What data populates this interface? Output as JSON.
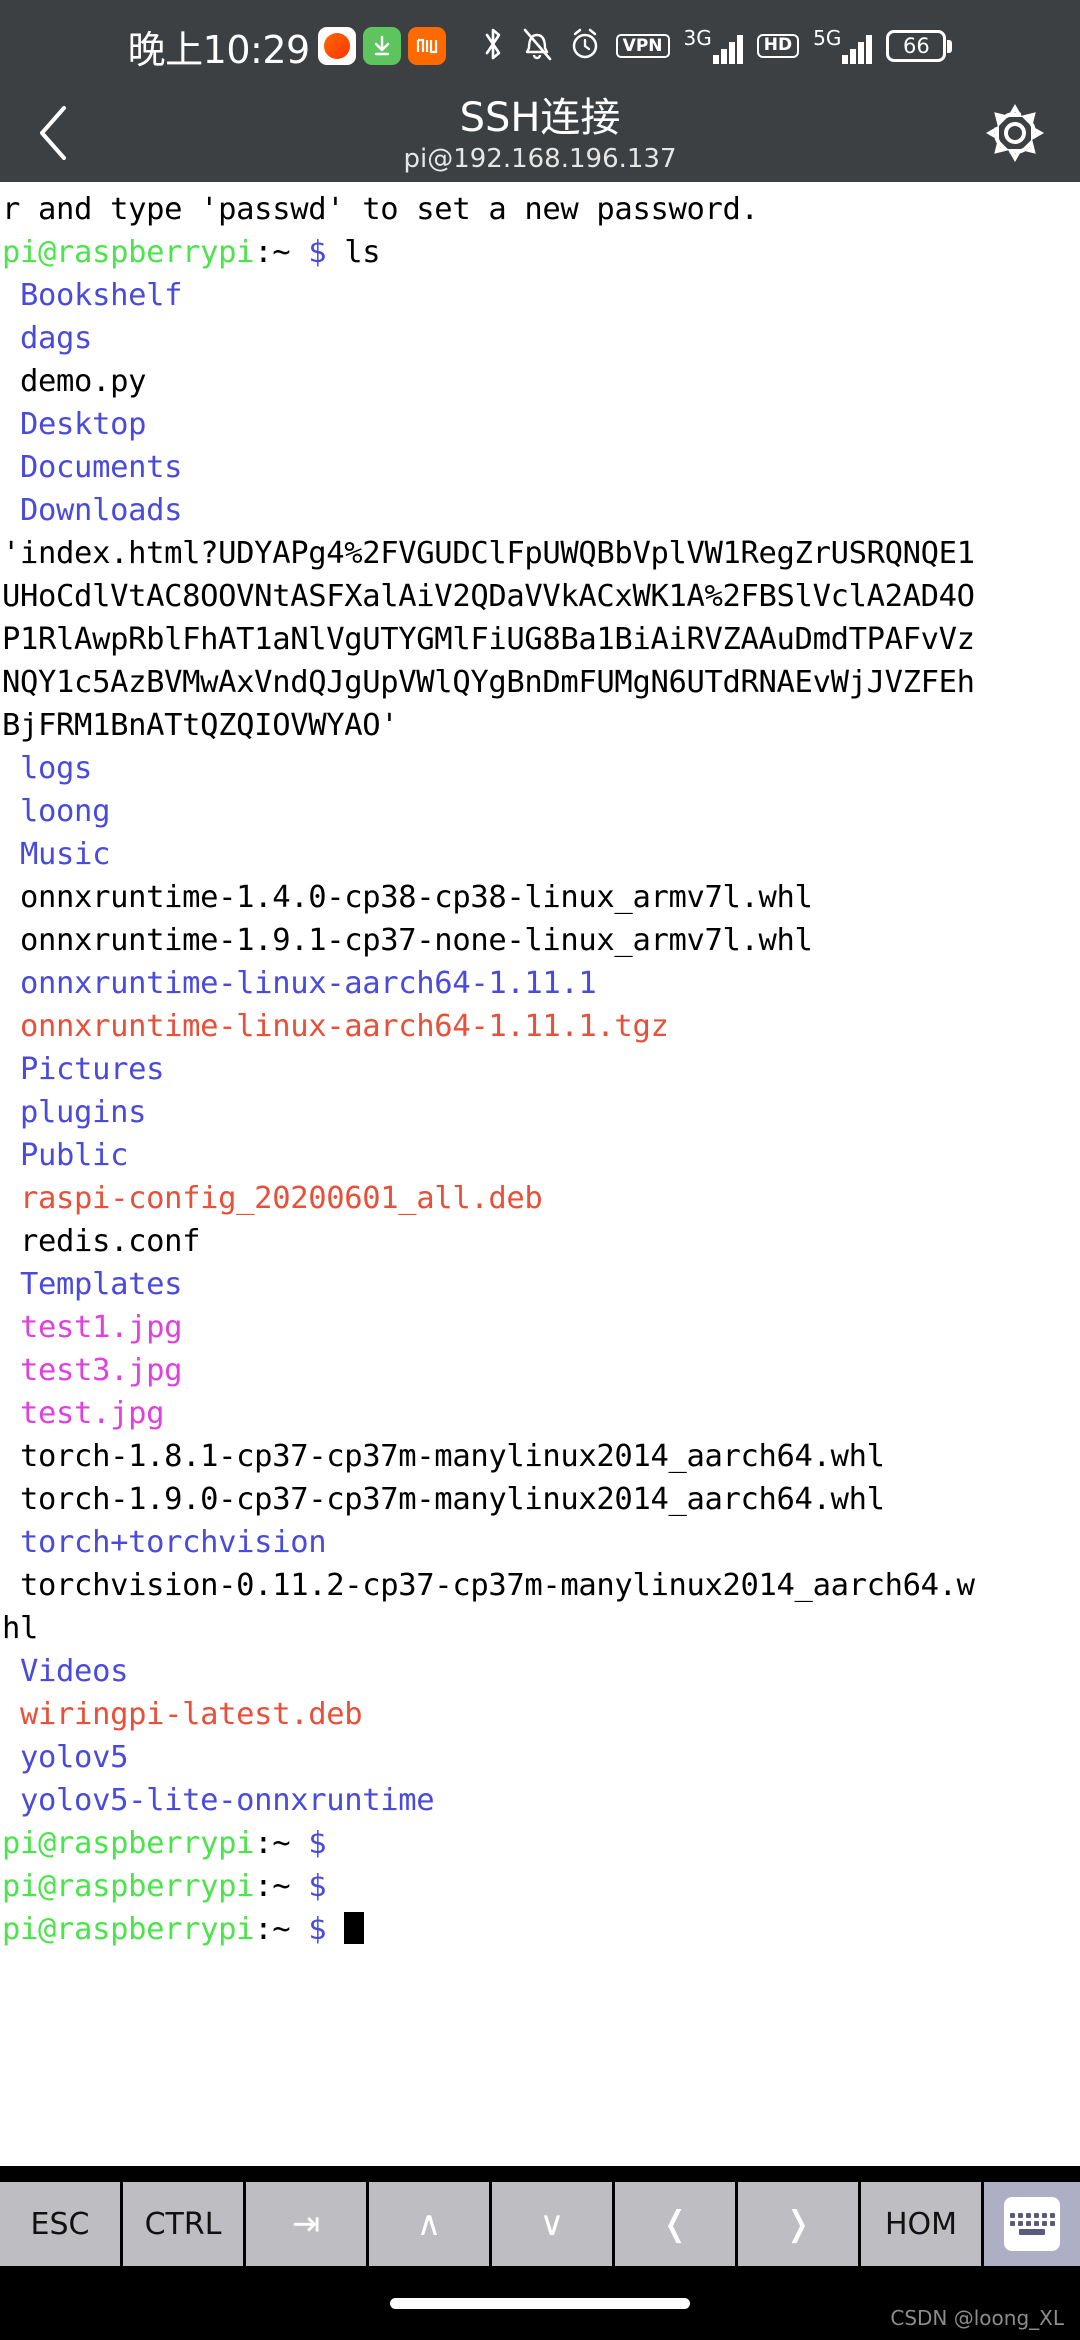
{
  "statusbar": {
    "time": "晚上10:29",
    "app_icons": [
      "taobao-icon",
      "download-icon",
      "mi-icon"
    ],
    "system_icons": [
      "bluetooth-icon",
      "vibrate-off-icon",
      "alarm-icon",
      "vpn-icon",
      "signal-3g-icon",
      "hd-icon",
      "signal-5g-icon",
      "battery-icon"
    ],
    "vpn_label": "VPN",
    "hd_label": "HD",
    "net_3g_label": "3G",
    "net_5g_label": "5G",
    "battery_level": "66"
  },
  "header": {
    "back_icon": "back-chevron-icon",
    "title": "SSH连接",
    "subtitle": "pi@192.168.196.137",
    "settings_icon": "gear-icon"
  },
  "terminal": {
    "lines": [
      {
        "segments": [
          {
            "text": "r and type 'passwd' to set a new password.",
            "color": "black"
          }
        ]
      },
      {
        "segments": [
          {
            "text": "",
            "color": "black"
          }
        ]
      },
      {
        "segments": [
          {
            "text": "pi@raspberrypi",
            "color": "green"
          },
          {
            "text": ":~ ",
            "color": "black"
          },
          {
            "text": "$",
            "color": "blue"
          },
          {
            "text": " ls",
            "color": "black"
          }
        ]
      },
      {
        "segments": [
          {
            "text": " Bookshelf",
            "color": "blue"
          }
        ]
      },
      {
        "segments": [
          {
            "text": " dags",
            "color": "blue"
          }
        ]
      },
      {
        "segments": [
          {
            "text": " demo.py",
            "color": "black"
          }
        ]
      },
      {
        "segments": [
          {
            "text": " Desktop",
            "color": "blue"
          }
        ]
      },
      {
        "segments": [
          {
            "text": " Documents",
            "color": "blue"
          }
        ]
      },
      {
        "segments": [
          {
            "text": " Downloads",
            "color": "blue"
          }
        ]
      },
      {
        "segments": [
          {
            "text": "'index.html?UDYAPg4%2FVGUDClFpUWQBbVplVW1RegZrUSRQNQE1",
            "color": "black"
          }
        ]
      },
      {
        "segments": [
          {
            "text": "UHoCdlVtAC8OOVNtASFXalAiV2QDaVVkACxWK1A%2FBSlVclA2AD4O",
            "color": "black"
          }
        ]
      },
      {
        "segments": [
          {
            "text": "P1RlAwpRblFhAT1aNlVgUTYGMlFiUG8Ba1BiAiRVZAAuDmdTPAFvVz",
            "color": "black"
          }
        ]
      },
      {
        "segments": [
          {
            "text": "NQY1c5AzBVMwAxVndQJgUpVWlQYgBnDmFUMgN6UTdRNAEvWjJVZFEh",
            "color": "black"
          }
        ]
      },
      {
        "segments": [
          {
            "text": "BjFRM1BnATtQZQIOVWYAO'",
            "color": "black"
          }
        ]
      },
      {
        "segments": [
          {
            "text": " logs",
            "color": "blue"
          }
        ]
      },
      {
        "segments": [
          {
            "text": " loong",
            "color": "blue"
          }
        ]
      },
      {
        "segments": [
          {
            "text": " Music",
            "color": "blue"
          }
        ]
      },
      {
        "segments": [
          {
            "text": " onnxruntime-1.4.0-cp38-cp38-linux_armv7l.whl",
            "color": "black"
          }
        ]
      },
      {
        "segments": [
          {
            "text": " onnxruntime-1.9.1-cp37-none-linux_armv7l.whl",
            "color": "black"
          }
        ]
      },
      {
        "segments": [
          {
            "text": " onnxruntime-linux-aarch64-1.11.1",
            "color": "blue"
          }
        ]
      },
      {
        "segments": [
          {
            "text": " onnxruntime-linux-aarch64-1.11.1.tgz",
            "color": "red"
          }
        ]
      },
      {
        "segments": [
          {
            "text": " Pictures",
            "color": "blue"
          }
        ]
      },
      {
        "segments": [
          {
            "text": " plugins",
            "color": "blue"
          }
        ]
      },
      {
        "segments": [
          {
            "text": " Public",
            "color": "blue"
          }
        ]
      },
      {
        "segments": [
          {
            "text": " raspi-config_20200601_all.deb",
            "color": "red"
          }
        ]
      },
      {
        "segments": [
          {
            "text": " redis.conf",
            "color": "black"
          }
        ]
      },
      {
        "segments": [
          {
            "text": " Templates",
            "color": "blue"
          }
        ]
      },
      {
        "segments": [
          {
            "text": " test1.jpg",
            "color": "magenta"
          }
        ]
      },
      {
        "segments": [
          {
            "text": " test3.jpg",
            "color": "magenta"
          }
        ]
      },
      {
        "segments": [
          {
            "text": " test.jpg",
            "color": "magenta"
          }
        ]
      },
      {
        "segments": [
          {
            "text": " torch-1.8.1-cp37-cp37m-manylinux2014_aarch64.whl",
            "color": "black"
          }
        ]
      },
      {
        "segments": [
          {
            "text": " torch-1.9.0-cp37-cp37m-manylinux2014_aarch64.whl",
            "color": "black"
          }
        ]
      },
      {
        "segments": [
          {
            "text": " torch+torchvision",
            "color": "blue"
          }
        ]
      },
      {
        "segments": [
          {
            "text": " torchvision-0.11.2-cp37-cp37m-manylinux2014_aarch64.w",
            "color": "black"
          }
        ]
      },
      {
        "segments": [
          {
            "text": "hl",
            "color": "black"
          }
        ]
      },
      {
        "segments": [
          {
            "text": " Videos",
            "color": "blue"
          }
        ]
      },
      {
        "segments": [
          {
            "text": " wiringpi-latest.deb",
            "color": "red"
          }
        ]
      },
      {
        "segments": [
          {
            "text": " yolov5",
            "color": "blue"
          }
        ]
      },
      {
        "segments": [
          {
            "text": " yolov5-lite-onnxruntime",
            "color": "blue"
          }
        ]
      },
      {
        "segments": [
          {
            "text": "pi@raspberrypi",
            "color": "green"
          },
          {
            "text": ":~ ",
            "color": "black"
          },
          {
            "text": "$",
            "color": "blue"
          }
        ]
      },
      {
        "segments": [
          {
            "text": "pi@raspberrypi",
            "color": "green"
          },
          {
            "text": ":~ ",
            "color": "black"
          },
          {
            "text": "$",
            "color": "blue"
          }
        ]
      },
      {
        "segments": [
          {
            "text": "pi@raspberrypi",
            "color": "green"
          },
          {
            "text": ":~ ",
            "color": "black"
          },
          {
            "text": "$",
            "color": "blue"
          },
          {
            "text": " ",
            "color": "black"
          },
          {
            "text": "",
            "color": "cursor"
          }
        ]
      }
    ],
    "colors": {
      "directory": "#4b4bdb",
      "archive": "#e8503a",
      "image": "#e040e0",
      "prompt_user": "#4ce44c",
      "prompt_symbol": "#4b4bdb",
      "text": "#000000",
      "background": "#ffffff"
    }
  },
  "keybar": {
    "keys": [
      {
        "label": "ESC",
        "icon": "esc-key",
        "type": "text"
      },
      {
        "label": "CTRL",
        "icon": "ctrl-key",
        "type": "text"
      },
      {
        "label": "⇥",
        "icon": "tab-key-icon",
        "type": "arrow"
      },
      {
        "label": "∧",
        "icon": "arrow-up-icon",
        "type": "arrow"
      },
      {
        "label": "∨",
        "icon": "arrow-down-icon",
        "type": "arrow"
      },
      {
        "label": "❬",
        "icon": "arrow-left-icon",
        "type": "arrow"
      },
      {
        "label": "❭",
        "icon": "arrow-right-icon",
        "type": "arrow"
      },
      {
        "label": "HOM",
        "icon": "home-key",
        "type": "text"
      }
    ],
    "keyboard_toggle_icon": "keyboard-icon"
  },
  "navbar": {
    "watermark": "CSDN @loong_XL"
  }
}
